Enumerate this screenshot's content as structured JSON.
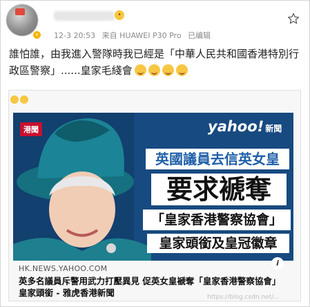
{
  "post": {
    "timestamp": "12-3 20:53",
    "device": "来自 HUAWEI P30 Pro",
    "edited": "已编辑",
    "text": "誰怕誰，由我進入警隊時我已經是「中華人民共和國香港特別行政區警察」......皇家毛綫會"
  },
  "link_card": {
    "image": {
      "tag": "港聞",
      "brand": "yahoo!",
      "brand_suffix": "新聞",
      "line1": "英國議員去信英女皇",
      "line2": "要求褫奪",
      "line3": "「皇家香港警察協會」",
      "line4": "皇家頭銜及皇冠徽章"
    },
    "source": "HK.NEWS.YAHOO.COM",
    "headline": "英多名議員斥警用武力打壓異見 促英女皇褫奪「皇家香港警察協會」皇家頭銜 - 雅虎香港新聞"
  },
  "watermark": "https://blog.csdn.net/...",
  "colors": {
    "accent_red": "#c8102e",
    "banner_blue": "#1f5fa8",
    "hat_teal": "#1c7a8a"
  }
}
